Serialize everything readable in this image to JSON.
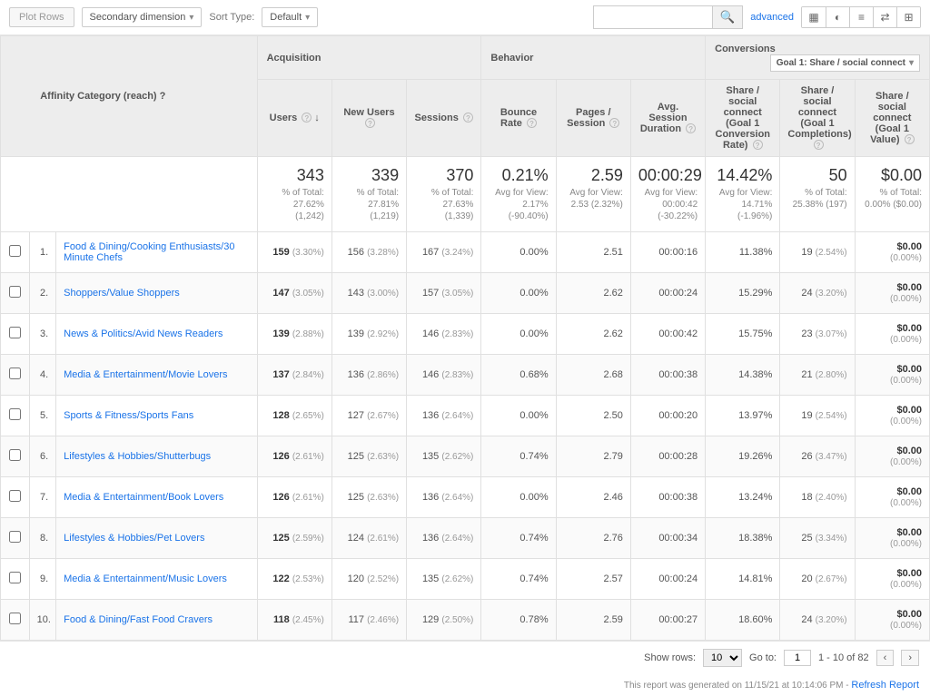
{
  "toolbar": {
    "plot_rows": "Plot Rows",
    "secondary_dim": "Secondary dimension",
    "sort_type_label": "Sort Type:",
    "sort_type_value": "Default",
    "advanced": "advanced",
    "search_placeholder": ""
  },
  "header": {
    "dimension_label": "Affinity Category (reach)",
    "groups": {
      "acquisition": "Acquisition",
      "behavior": "Behavior",
      "conversions": "Conversions"
    },
    "conversion_selector": "Goal 1: Share / social connect",
    "columns": {
      "users": "Users",
      "new_users": "New Users",
      "sessions": "Sessions",
      "bounce_rate": "Bounce Rate",
      "pages_session": "Pages / Session",
      "avg_duration": "Avg. Session Duration",
      "conv_rate": "Share / social connect (Goal 1 Conversion Rate)",
      "completions": "Share / social connect (Goal 1 Completions)",
      "value": "Share / social connect (Goal 1 Value)"
    }
  },
  "summary": {
    "users": {
      "big": "343",
      "sub": "% of Total: 27.62% (1,242)"
    },
    "new_users": {
      "big": "339",
      "sub": "% of Total: 27.81% (1,219)"
    },
    "sessions": {
      "big": "370",
      "sub": "% of Total: 27.63% (1,339)"
    },
    "bounce_rate": {
      "big": "0.21%",
      "sub": "Avg for View: 2.17% (-90.40%)"
    },
    "pages": {
      "big": "2.59",
      "sub": "Avg for View: 2.53 (2.32%)"
    },
    "duration": {
      "big": "00:00:29",
      "sub": "Avg for View: 00:00:42 (-30.22%)"
    },
    "conv_rate": {
      "big": "14.42%",
      "sub": "Avg for View: 14.71% (-1.96%)"
    },
    "completions": {
      "big": "50",
      "sub": "% of Total: 25.38% (197)"
    },
    "value": {
      "big": "$0.00",
      "sub": "% of Total: 0.00% ($0.00)"
    }
  },
  "rows": [
    {
      "idx": "1.",
      "name": "Food & Dining/Cooking Enthusiasts/30 Minute Chefs",
      "users": "159",
      "users_pct": "(3.30%)",
      "new": "156",
      "new_pct": "(3.28%)",
      "sess": "167",
      "sess_pct": "(3.24%)",
      "bounce": "0.00%",
      "pages": "2.51",
      "dur": "00:00:16",
      "rate": "11.38%",
      "comp": "19",
      "comp_pct": "(2.54%)",
      "val": "$0.00",
      "val_pct": "(0.00%)"
    },
    {
      "idx": "2.",
      "name": "Shoppers/Value Shoppers",
      "users": "147",
      "users_pct": "(3.05%)",
      "new": "143",
      "new_pct": "(3.00%)",
      "sess": "157",
      "sess_pct": "(3.05%)",
      "bounce": "0.00%",
      "pages": "2.62",
      "dur": "00:00:24",
      "rate": "15.29%",
      "comp": "24",
      "comp_pct": "(3.20%)",
      "val": "$0.00",
      "val_pct": "(0.00%)"
    },
    {
      "idx": "3.",
      "name": "News & Politics/Avid News Readers",
      "users": "139",
      "users_pct": "(2.88%)",
      "new": "139",
      "new_pct": "(2.92%)",
      "sess": "146",
      "sess_pct": "(2.83%)",
      "bounce": "0.00%",
      "pages": "2.62",
      "dur": "00:00:42",
      "rate": "15.75%",
      "comp": "23",
      "comp_pct": "(3.07%)",
      "val": "$0.00",
      "val_pct": "(0.00%)"
    },
    {
      "idx": "4.",
      "name": "Media & Entertainment/Movie Lovers",
      "users": "137",
      "users_pct": "(2.84%)",
      "new": "136",
      "new_pct": "(2.86%)",
      "sess": "146",
      "sess_pct": "(2.83%)",
      "bounce": "0.68%",
      "pages": "2.68",
      "dur": "00:00:38",
      "rate": "14.38%",
      "comp": "21",
      "comp_pct": "(2.80%)",
      "val": "$0.00",
      "val_pct": "(0.00%)"
    },
    {
      "idx": "5.",
      "name": "Sports & Fitness/Sports Fans",
      "users": "128",
      "users_pct": "(2.65%)",
      "new": "127",
      "new_pct": "(2.67%)",
      "sess": "136",
      "sess_pct": "(2.64%)",
      "bounce": "0.00%",
      "pages": "2.50",
      "dur": "00:00:20",
      "rate": "13.97%",
      "comp": "19",
      "comp_pct": "(2.54%)",
      "val": "$0.00",
      "val_pct": "(0.00%)"
    },
    {
      "idx": "6.",
      "name": "Lifestyles & Hobbies/Shutterbugs",
      "users": "126",
      "users_pct": "(2.61%)",
      "new": "125",
      "new_pct": "(2.63%)",
      "sess": "135",
      "sess_pct": "(2.62%)",
      "bounce": "0.74%",
      "pages": "2.79",
      "dur": "00:00:28",
      "rate": "19.26%",
      "comp": "26",
      "comp_pct": "(3.47%)",
      "val": "$0.00",
      "val_pct": "(0.00%)"
    },
    {
      "idx": "7.",
      "name": "Media & Entertainment/Book Lovers",
      "users": "126",
      "users_pct": "(2.61%)",
      "new": "125",
      "new_pct": "(2.63%)",
      "sess": "136",
      "sess_pct": "(2.64%)",
      "bounce": "0.00%",
      "pages": "2.46",
      "dur": "00:00:38",
      "rate": "13.24%",
      "comp": "18",
      "comp_pct": "(2.40%)",
      "val": "$0.00",
      "val_pct": "(0.00%)"
    },
    {
      "idx": "8.",
      "name": "Lifestyles & Hobbies/Pet Lovers",
      "users": "125",
      "users_pct": "(2.59%)",
      "new": "124",
      "new_pct": "(2.61%)",
      "sess": "136",
      "sess_pct": "(2.64%)",
      "bounce": "0.74%",
      "pages": "2.76",
      "dur": "00:00:34",
      "rate": "18.38%",
      "comp": "25",
      "comp_pct": "(3.34%)",
      "val": "$0.00",
      "val_pct": "(0.00%)"
    },
    {
      "idx": "9.",
      "name": "Media & Entertainment/Music Lovers",
      "users": "122",
      "users_pct": "(2.53%)",
      "new": "120",
      "new_pct": "(2.52%)",
      "sess": "135",
      "sess_pct": "(2.62%)",
      "bounce": "0.74%",
      "pages": "2.57",
      "dur": "00:00:24",
      "rate": "14.81%",
      "comp": "20",
      "comp_pct": "(2.67%)",
      "val": "$0.00",
      "val_pct": "(0.00%)"
    },
    {
      "idx": "10.",
      "name": "Food & Dining/Fast Food Cravers",
      "users": "118",
      "users_pct": "(2.45%)",
      "new": "117",
      "new_pct": "(2.46%)",
      "sess": "129",
      "sess_pct": "(2.50%)",
      "bounce": "0.78%",
      "pages": "2.59",
      "dur": "00:00:27",
      "rate": "18.60%",
      "comp": "24",
      "comp_pct": "(3.20%)",
      "val": "$0.00",
      "val_pct": "(0.00%)"
    }
  ],
  "footer": {
    "show_rows_label": "Show rows:",
    "show_rows_value": "10",
    "goto_label": "Go to:",
    "goto_value": "1",
    "range": "1 - 10 of 82",
    "generated": "This report was generated on 11/15/21 at 10:14:06 PM - ",
    "refresh": "Refresh Report"
  }
}
